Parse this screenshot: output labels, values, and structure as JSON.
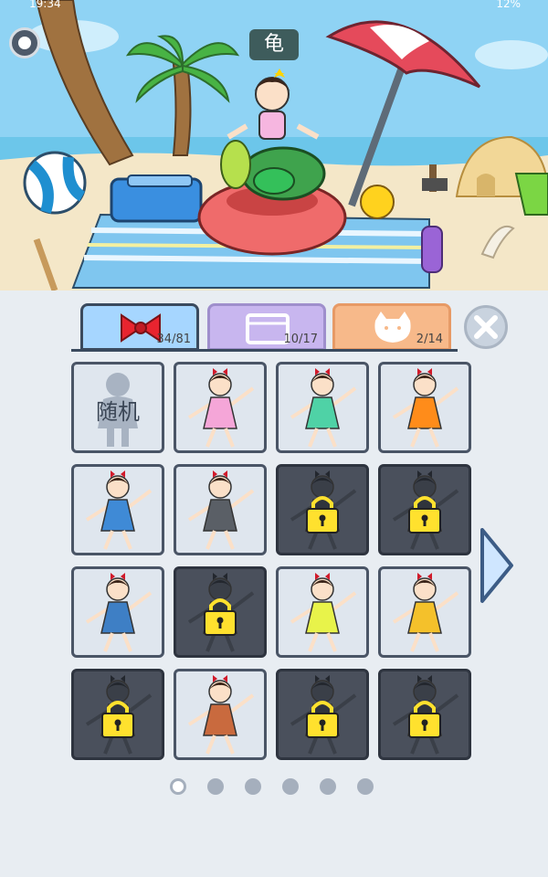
{
  "status_bar": {
    "time": "19:34",
    "battery": "12%"
  },
  "scene": {
    "character_name": "龟"
  },
  "tabs": [
    {
      "name": "outfits",
      "count": "34/81",
      "selected": true
    },
    {
      "name": "furniture",
      "count": "10/17",
      "selected": false
    },
    {
      "name": "pets",
      "count": "2/14",
      "selected": false
    }
  ],
  "grid": {
    "random_label": "随机",
    "items": [
      {
        "outfit": "random",
        "locked": false
      },
      {
        "outfit": "pink-dress",
        "color": "#f5a6d8",
        "locked": false
      },
      {
        "outfit": "teal-dress",
        "color": "#4fd2a6",
        "locked": false
      },
      {
        "outfit": "orange-dress",
        "color": "#ff8c1a",
        "locked": false
      },
      {
        "outfit": "blue-dress",
        "color": "#3f8ad6",
        "locked": false
      },
      {
        "outfit": "gray-dress-glasses",
        "color": "#5a5f66",
        "locked": false
      },
      {
        "outfit": "hat-outfit",
        "locked": true
      },
      {
        "outfit": "dark-outfit",
        "locked": true
      },
      {
        "outfit": "blue-polka-dress",
        "color": "#3e7fc5",
        "locked": false
      },
      {
        "outfit": "dark-outfit",
        "locked": true
      },
      {
        "outfit": "yellow-leaf-dress",
        "color": "#e8f34a",
        "locked": false
      },
      {
        "outfit": "yellow-hoodie-jeans",
        "color": "#f4c12b",
        "locked": false
      },
      {
        "outfit": "dark-outfit",
        "locked": true
      },
      {
        "outfit": "gardener-apron",
        "color": "#c96a3e",
        "locked": false
      },
      {
        "outfit": "watering-can-outfit",
        "locked": true
      },
      {
        "outfit": "bat-outfit",
        "locked": true
      }
    ]
  },
  "pagination": {
    "pages": 6,
    "current": 1
  },
  "colors": {
    "sky": "#8fd3f4",
    "sand": "#f4e7c8",
    "panel": "#e8edf2",
    "lock": "#ffe12e"
  }
}
